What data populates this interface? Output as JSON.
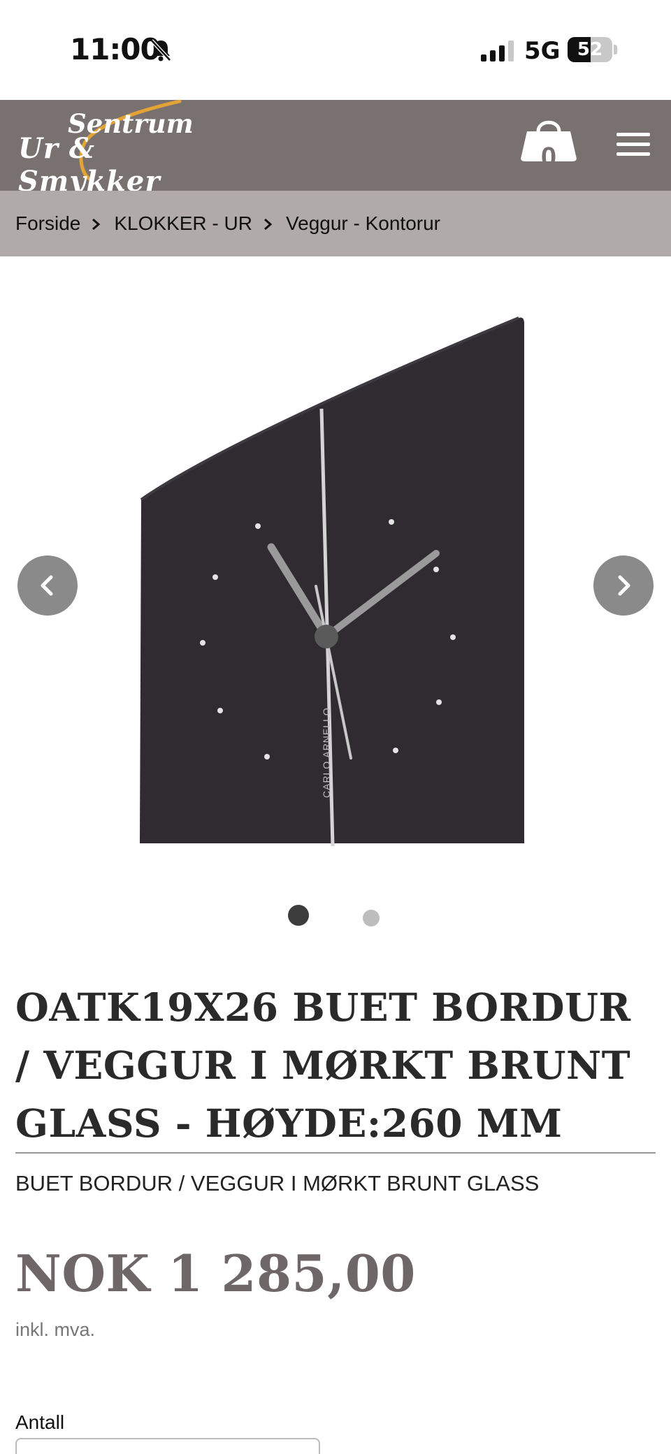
{
  "status_bar": {
    "time": "11:00",
    "network": "5G",
    "battery": "52",
    "battery_level_percent": 52,
    "icons": [
      "bell-muted-icon",
      "signal-icon"
    ]
  },
  "header": {
    "logo_line1": "Sentrum",
    "logo_line2": "Ur & Smykker",
    "cart_count": "0",
    "icons": [
      "shopping-bag-icon",
      "hamburger-menu-icon"
    ],
    "colors": {
      "header_bg": "#787170",
      "logo_accent": "#e3a335"
    }
  },
  "breadcrumb": {
    "items": [
      "Forside",
      "KLOKKER - UR",
      "Veggur - Kontorur"
    ],
    "bg": "#b0aaaa"
  },
  "gallery": {
    "image_brand_text": "CARLO ARNELLO",
    "slide_count": 2,
    "active_slide": 1
  },
  "product": {
    "title": "OATK19X26 BUET BORDUR / VEGGUR I MØRKT BRUNT GLASS - HØYDE:260 MM",
    "subtitle": "BUET BORDUR / VEGGUR I MØRKT BRUNT GLASS",
    "price": "NOK 1 285,00",
    "vat_note": "inkl. mva.",
    "quantity_label": "Antall",
    "price_color": "#6f6767"
  }
}
